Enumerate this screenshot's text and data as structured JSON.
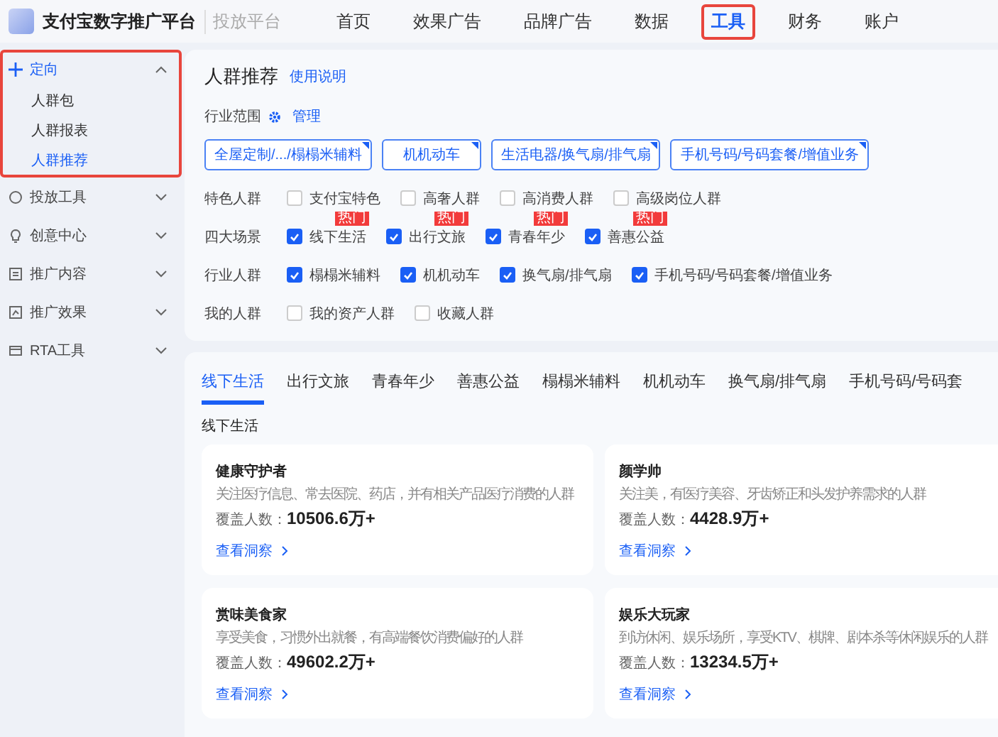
{
  "header": {
    "brand": "支付宝数字推广平台",
    "subtitle": "投放平台",
    "nav": [
      {
        "label": "首页",
        "selected": false
      },
      {
        "label": "效果广告",
        "selected": false
      },
      {
        "label": "品牌广告",
        "selected": false
      },
      {
        "label": "数据",
        "selected": false
      },
      {
        "label": "工具",
        "selected": true
      },
      {
        "label": "财务",
        "selected": false
      },
      {
        "label": "账户",
        "selected": false
      }
    ]
  },
  "sidebar": {
    "groups": [
      {
        "label": "定向",
        "kind": "target",
        "expanded": true,
        "children": [
          {
            "label": "人群包",
            "selected": false
          },
          {
            "label": "人群报表",
            "selected": false
          },
          {
            "label": "人群推荐",
            "selected": true
          }
        ]
      },
      {
        "label": "投放工具",
        "kind": "circle",
        "expanded": false
      },
      {
        "label": "创意中心",
        "kind": "bulb",
        "expanded": false
      },
      {
        "label": "推广内容",
        "kind": "doc",
        "expanded": false
      },
      {
        "label": "推广效果",
        "kind": "chart",
        "expanded": false
      },
      {
        "label": "RTA工具",
        "kind": "rta",
        "expanded": false
      }
    ]
  },
  "panel": {
    "title": "人群推荐",
    "help_link": "使用说明",
    "scope_label": "行业范围",
    "manage": "管理",
    "chips": [
      "全屋定制/.../榻榻米辅料",
      "机机动车",
      "生活电器/换气扇/排气扇",
      "手机号码/号码套餐/增值业务"
    ],
    "filters": [
      {
        "label": "特色人群",
        "options": [
          {
            "label": "支付宝特色",
            "checked": false
          },
          {
            "label": "高奢人群",
            "checked": false
          },
          {
            "label": "高消费人群",
            "checked": false
          },
          {
            "label": "高级岗位人群",
            "checked": false
          }
        ]
      },
      {
        "label": "四大场景",
        "options": [
          {
            "label": "线下生活",
            "checked": true,
            "badge": "热门"
          },
          {
            "label": "出行文旅",
            "checked": true,
            "badge": "热门"
          },
          {
            "label": "青春年少",
            "checked": true,
            "badge": "热门"
          },
          {
            "label": "善惠公益",
            "checked": true,
            "badge": "热门"
          }
        ]
      },
      {
        "label": "行业人群",
        "options": [
          {
            "label": "榻榻米辅料",
            "checked": true
          },
          {
            "label": "机机动车",
            "checked": true
          },
          {
            "label": "换气扇/排气扇",
            "checked": true
          },
          {
            "label": "手机号码/号码套餐/增值业务",
            "checked": true
          }
        ]
      },
      {
        "label": "我的人群",
        "options": [
          {
            "label": "我的资产人群",
            "checked": false
          },
          {
            "label": "收藏人群",
            "checked": false
          }
        ]
      }
    ]
  },
  "results": {
    "tabs": [
      {
        "label": "线下生活",
        "selected": true
      },
      {
        "label": "出行文旅",
        "selected": false
      },
      {
        "label": "青春年少",
        "selected": false
      },
      {
        "label": "善惠公益",
        "selected": false
      },
      {
        "label": "榻榻米辅料",
        "selected": false
      },
      {
        "label": "机机动车",
        "selected": false
      },
      {
        "label": "换气扇/排气扇",
        "selected": false
      },
      {
        "label": "手机号码/号码套",
        "selected": false
      }
    ],
    "section_title": "线下生活",
    "cards": [
      {
        "title": "健康守护者",
        "description": "关注医疗信息、常去医院、药店，并有相关产品医疗消费的人群",
        "coverage_label": "覆盖人数：",
        "coverage": "10506.6万+",
        "link": "查看洞察"
      },
      {
        "title": "颜学帅",
        "description": "关注美，有医疗美容、牙齿矫正和头发护养需求的人群",
        "coverage_label": "覆盖人数：",
        "coverage": "4428.9万+",
        "link": "查看洞察"
      },
      {
        "title": "赏味美食家",
        "description": "享受美食，习惯外出就餐，有高端餐饮消费偏好的人群",
        "coverage_label": "覆盖人数：",
        "coverage": "49602.2万+",
        "link": "查看洞察"
      },
      {
        "title": "娱乐大玩家",
        "description": "到访休闲、娱乐场所，享受KTV、棋牌、剧本杀等休闲娱乐的人群",
        "coverage_label": "覆盖人数：",
        "coverage": "13234.5万+",
        "link": "查看洞察"
      }
    ]
  }
}
